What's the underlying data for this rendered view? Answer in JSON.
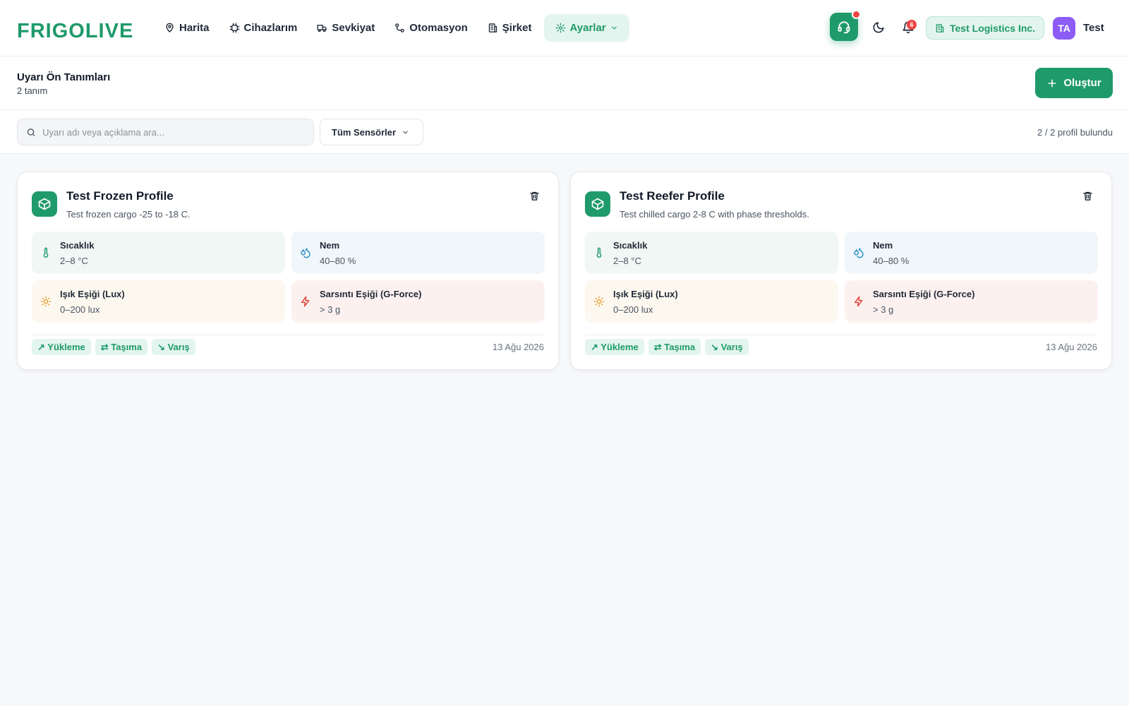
{
  "app": {
    "brand": "FRIGOLIVE",
    "accent": "#1f9a6b"
  },
  "nav": {
    "items": [
      {
        "label": "Harita",
        "icon": "map-pin-icon"
      },
      {
        "label": "Cihazlarım",
        "icon": "chip-icon"
      },
      {
        "label": "Sevkiyat",
        "icon": "truck-icon"
      },
      {
        "label": "Otomasyon",
        "icon": "workflow-icon"
      },
      {
        "label": "Şirket",
        "icon": "building-icon"
      },
      {
        "label": "Ayarlar",
        "icon": "gear-icon",
        "active": true
      }
    ]
  },
  "topright": {
    "notification_count": "6",
    "company": "Test Logistics Inc.",
    "avatar_initials": "TA",
    "username": "Test"
  },
  "header": {
    "title": "Uyarı Ön Tanımları",
    "subtitle": "2 tanım",
    "create_label": "Oluştur"
  },
  "filters": {
    "search_placeholder": "Uyarı adı veya açıklama ara...",
    "sensor_select": "Tüm Sensörler",
    "result_count": "2 / 2 profil bulundu"
  },
  "cards": [
    {
      "title": "Test Frozen Profile",
      "description": "Test frozen cargo -25 to -18 C.",
      "metrics": [
        {
          "label": "Sıcaklık",
          "value": "2–8 °C",
          "icon": "thermometer-icon"
        },
        {
          "label": "Nem",
          "value": "40–80 %",
          "icon": "droplets-icon"
        },
        {
          "label": "Işık Eşiği (Lux)",
          "value": "0–200 lux",
          "icon": "sun-icon"
        },
        {
          "label": "Sarsıntı Eşiği (G-Force)",
          "value": "> 3 g",
          "icon": "zap-icon"
        }
      ],
      "tags": [
        "↗ Yükleme",
        "⇄ Taşıma",
        "↘ Varış"
      ],
      "date": "13 Ağu 2026"
    },
    {
      "title": "Test Reefer Profile",
      "description": "Test chilled cargo 2-8 C with phase thresholds.",
      "metrics": [
        {
          "label": "Sıcaklık",
          "value": "2–8 °C",
          "icon": "thermometer-icon"
        },
        {
          "label": "Nem",
          "value": "40–80 %",
          "icon": "droplets-icon"
        },
        {
          "label": "Işık Eşiği (Lux)",
          "value": "0–200 lux",
          "icon": "sun-icon"
        },
        {
          "label": "Sarsıntı Eşiği (G-Force)",
          "value": "> 3 g",
          "icon": "zap-icon"
        }
      ],
      "tags": [
        "↗ Yükleme",
        "⇄ Taşıma",
        "↘ Varış"
      ],
      "date": "13 Ağu 2026"
    }
  ]
}
